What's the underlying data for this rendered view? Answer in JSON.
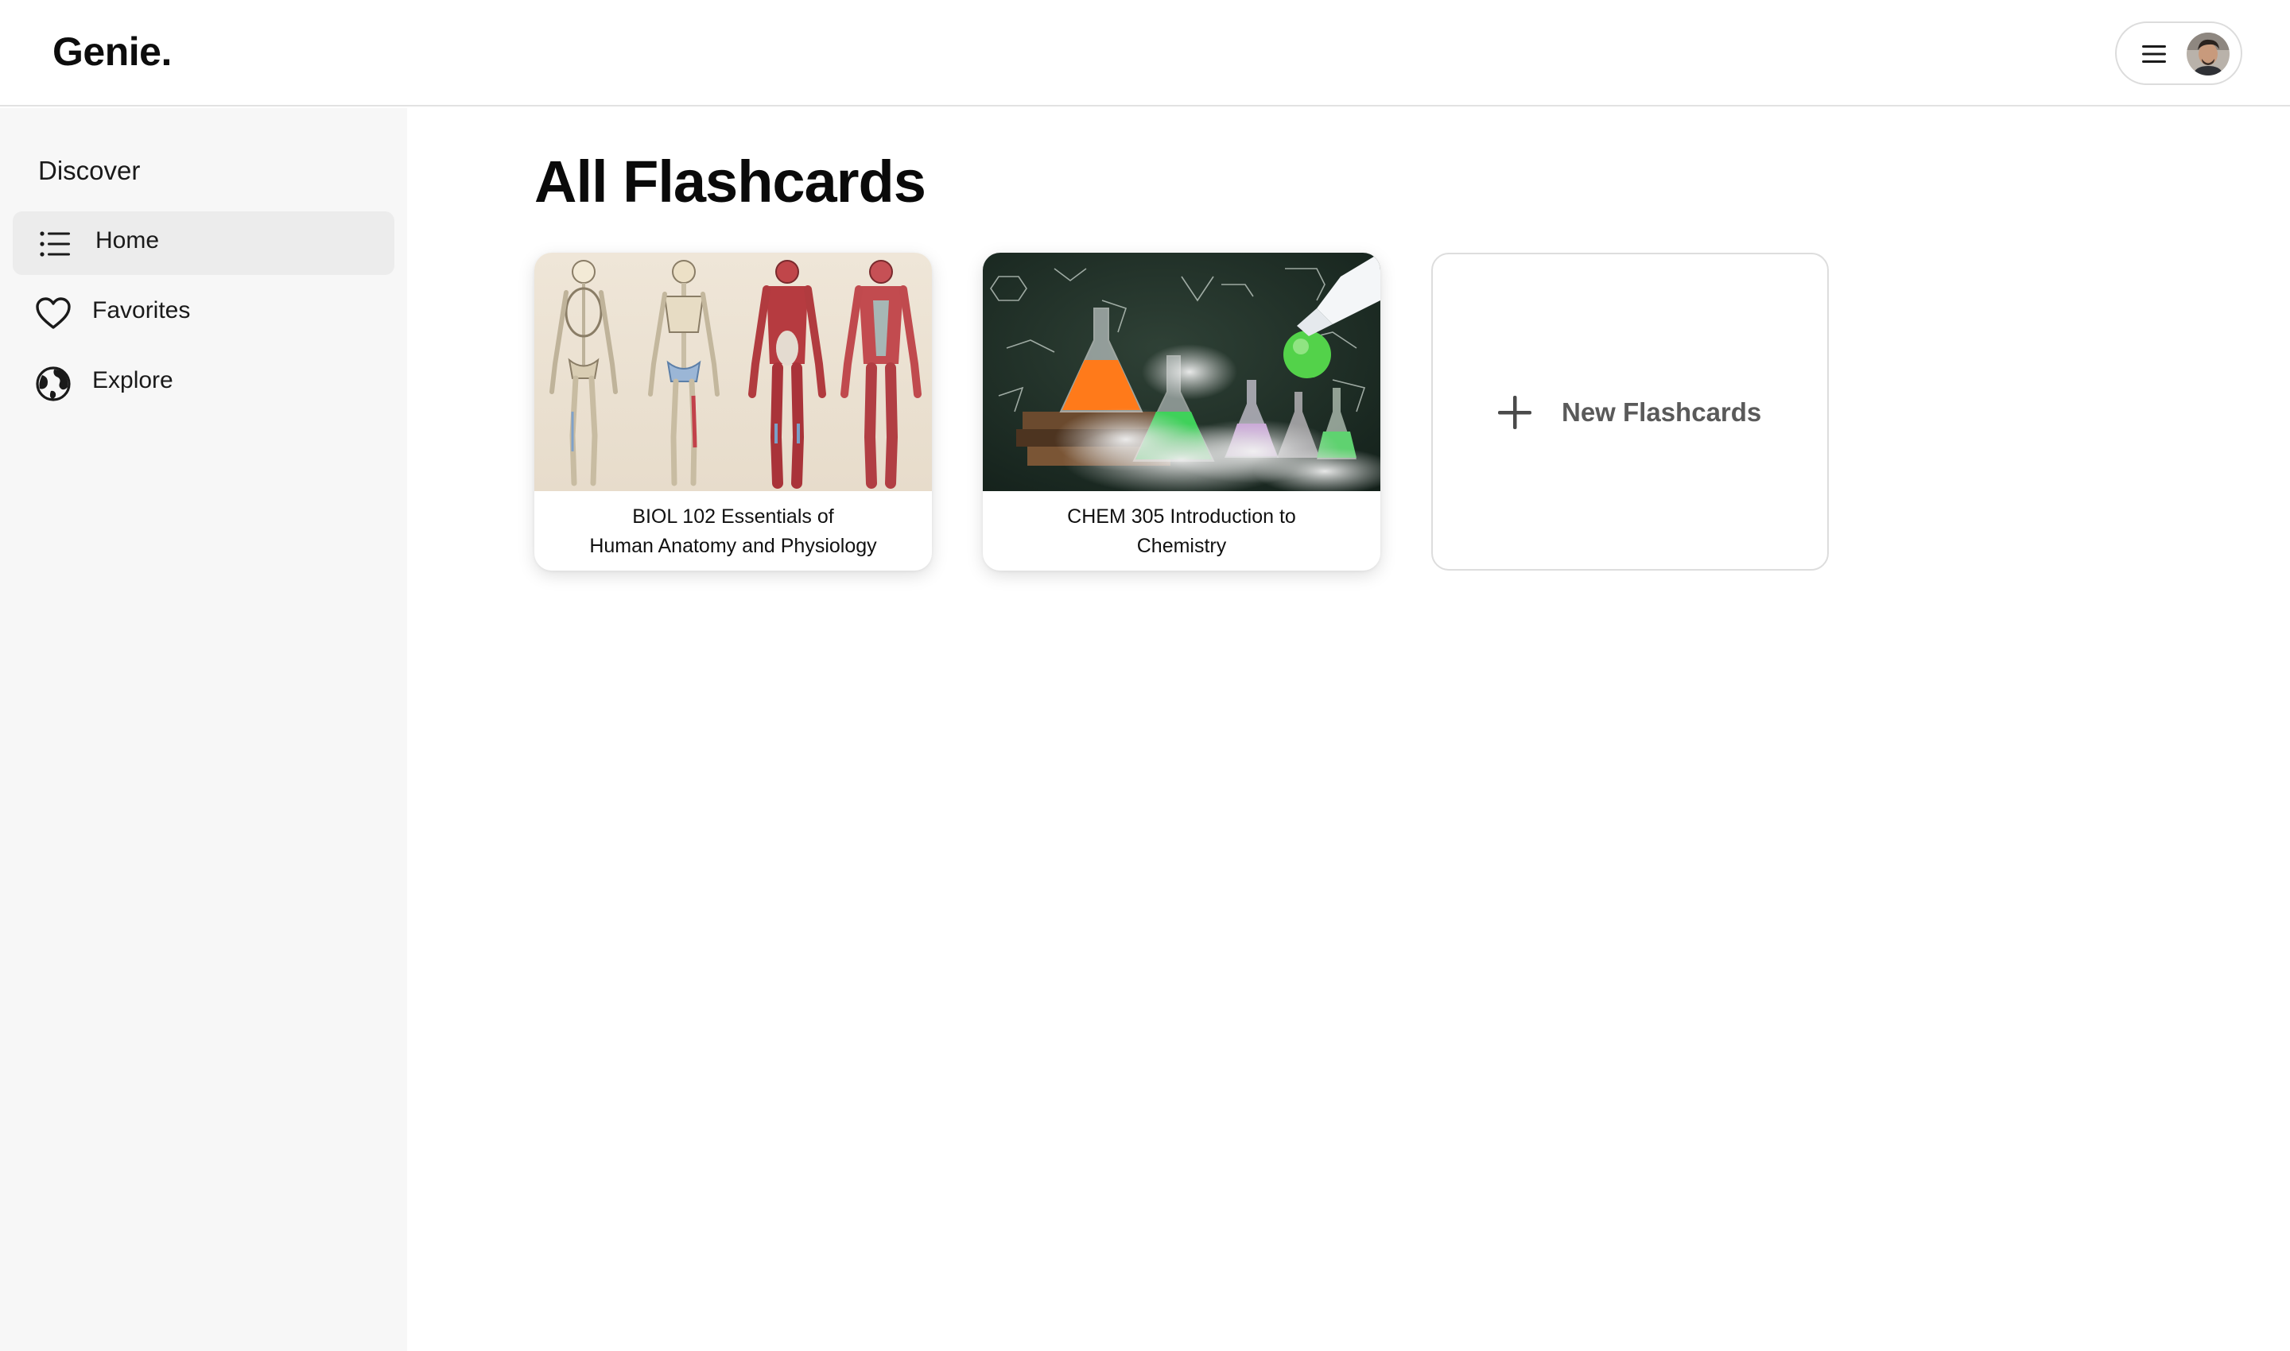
{
  "app": {
    "logo": "Genie."
  },
  "header": {
    "menu_icon": "hamburger-menu-icon",
    "avatar_icon": "user-avatar"
  },
  "sidebar": {
    "heading": "Discover",
    "items": [
      {
        "label": "Home",
        "icon": "list-icon",
        "active": true
      },
      {
        "label": "Favorites",
        "icon": "heart-icon",
        "active": false
      },
      {
        "label": "Explore",
        "icon": "globe-icon",
        "active": false
      }
    ]
  },
  "main": {
    "title": "All Flashcards",
    "cards": [
      {
        "title_line1": "BIOL 102 Essentials of",
        "title_line2": "Human Anatomy and Physiology",
        "image": "anatomy-illustration"
      },
      {
        "title_line1": "CHEM 305 Introduction to",
        "title_line2": "Chemistry",
        "image": "chemistry-lab-photo"
      }
    ],
    "new_card": {
      "label": "New Flashcards",
      "icon": "plus-icon"
    }
  },
  "colors": {
    "sidebar_bg": "#f7f7f7",
    "active_item_bg": "#ececec",
    "border": "#dddddd",
    "text": "#111111",
    "muted_text": "#5a5a5a"
  }
}
